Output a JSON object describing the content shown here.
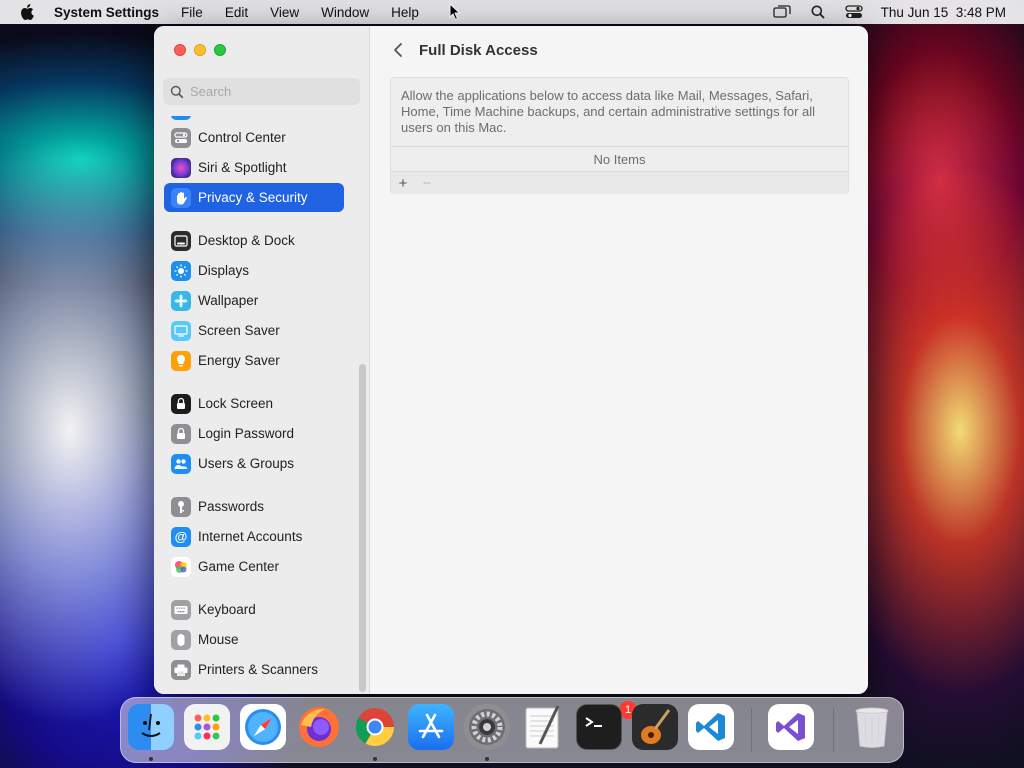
{
  "menubar": {
    "app_name": "System Settings",
    "menus": [
      "File",
      "Edit",
      "View",
      "Window",
      "Help"
    ],
    "clock": "Thu Jun 15  3:48 PM"
  },
  "sidebar": {
    "search_placeholder": "Search",
    "items": [
      {
        "label": "Control Center",
        "icon": "control-center-icon",
        "color": "#8e8e93"
      },
      {
        "label": "Siri & Spotlight",
        "icon": "siri-icon",
        "color": "#5a3fd0"
      },
      {
        "label": "Privacy & Security",
        "icon": "hand-icon",
        "color": "#1f63e3",
        "selected": true
      },
      {
        "label": "Desktop & Dock",
        "icon": "dock-icon",
        "color": "#2b2b2b"
      },
      {
        "label": "Displays",
        "icon": "sun-icon",
        "color": "#1f8ef1"
      },
      {
        "label": "Wallpaper",
        "icon": "flower-icon",
        "color": "#37b7ea"
      },
      {
        "label": "Screen Saver",
        "icon": "screen-saver-icon",
        "color": "#5ac8fa"
      },
      {
        "label": "Energy Saver",
        "icon": "lightbulb-icon",
        "color": "#ff9f0a"
      },
      {
        "label": "Lock Screen",
        "icon": "lock-icon",
        "color": "#1c1c1e"
      },
      {
        "label": "Login Password",
        "icon": "lock-small-icon",
        "color": "#8e8e93"
      },
      {
        "label": "Users & Groups",
        "icon": "users-icon",
        "color": "#1f8ef1"
      },
      {
        "label": "Passwords",
        "icon": "key-icon",
        "color": "#8e8e93"
      },
      {
        "label": "Internet Accounts",
        "icon": "at-icon",
        "color": "#1f8ef1"
      },
      {
        "label": "Game Center",
        "icon": "game-center-icon",
        "color": "#ffffff"
      },
      {
        "label": "Keyboard",
        "icon": "keyboard-icon",
        "color": "#a0a0a5"
      },
      {
        "label": "Mouse",
        "icon": "mouse-icon",
        "color": "#a0a0a5"
      },
      {
        "label": "Printers & Scanners",
        "icon": "printer-icon",
        "color": "#8e8e93"
      }
    ]
  },
  "content": {
    "title": "Full Disk Access",
    "description": "Allow the applications below to access data like Mail, Messages, Safari, Home, Time Machine backups, and certain administrative settings for all users on this Mac.",
    "empty_text": "No Items",
    "add_label": "+",
    "remove_label": "−"
  },
  "dock": {
    "apps": [
      "Finder",
      "Launchpad",
      "Safari",
      "Firefox",
      "Google Chrome",
      "App Store",
      "System Settings",
      "TextEdit",
      "Terminal",
      "GarageBand",
      "Visual Studio Code",
      "Visual Studio",
      "Trash"
    ],
    "settings_badge": "1"
  }
}
